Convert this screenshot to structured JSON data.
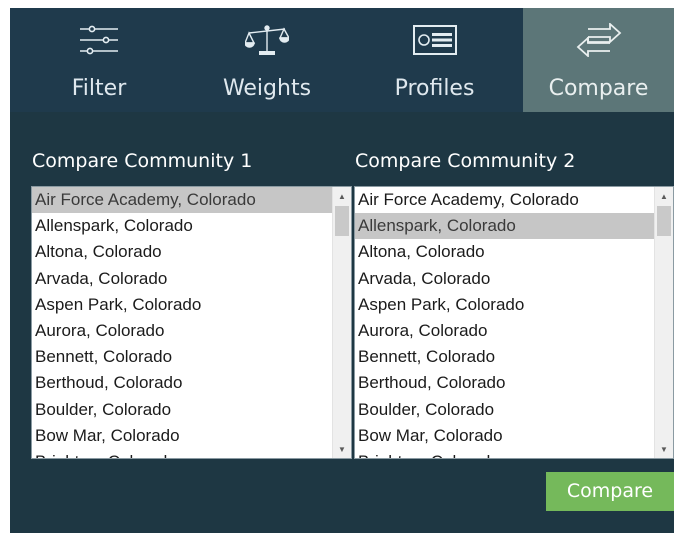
{
  "nav": {
    "items": [
      {
        "label": "Filter",
        "icon": "sliders-icon"
      },
      {
        "label": "Weights",
        "icon": "balance-scale-icon"
      },
      {
        "label": "Profiles",
        "icon": "id-card-icon"
      },
      {
        "label": "Compare",
        "icon": "swap-arrows-icon",
        "active": true
      }
    ]
  },
  "colors": {
    "nav_bg": "#1f3a4c",
    "active_tab": "#5c7678",
    "content_bg": "#1e3743",
    "button": "#75b95b",
    "selected_row": "#c6c6c6"
  },
  "compare": {
    "col1_title": "Compare Community 1",
    "col2_title": "Compare Community 2",
    "list1_selected": "Air Force Academy, Colorado",
    "list2_selected": "Allenspark, Colorado",
    "items": [
      "Air Force Academy, Colorado",
      "Allenspark, Colorado",
      "Altona, Colorado",
      "Arvada, Colorado",
      "Aspen Park, Colorado",
      "Aurora, Colorado",
      "Bennett, Colorado",
      "Berthoud, Colorado",
      "Boulder, Colorado",
      "Bow Mar, Colorado",
      "Brighton, Colorado"
    ],
    "button_label": "Compare"
  }
}
